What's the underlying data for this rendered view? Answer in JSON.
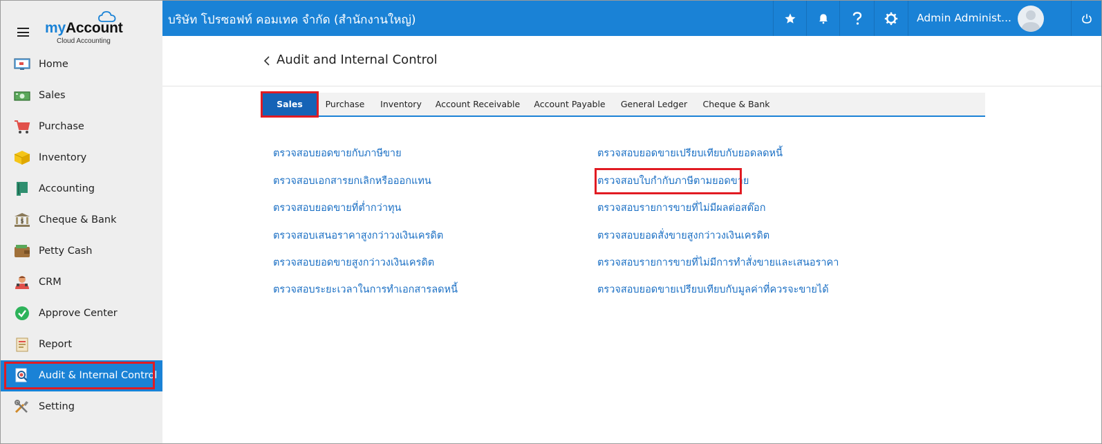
{
  "app": {
    "brand_my": "my",
    "brand_account": "Account",
    "brand_sub": "Cloud Accounting"
  },
  "sidebar": {
    "items": [
      {
        "label": "Home",
        "icon": "monitor-icon"
      },
      {
        "label": "Sales",
        "icon": "money-icon"
      },
      {
        "label": "Purchase",
        "icon": "cart-icon"
      },
      {
        "label": "Inventory",
        "icon": "box-icon"
      },
      {
        "label": "Accounting",
        "icon": "ledger-book-icon"
      },
      {
        "label": "Cheque & Bank",
        "icon": "bank-icon"
      },
      {
        "label": "Petty Cash",
        "icon": "wallet-icon"
      },
      {
        "label": "CRM",
        "icon": "people-icon"
      },
      {
        "label": "Approve Center",
        "icon": "check-circle-icon"
      },
      {
        "label": "Report",
        "icon": "report-icon"
      },
      {
        "label": "Audit & Internal Control",
        "icon": "audit-search-icon",
        "active": true
      },
      {
        "label": "Setting",
        "icon": "tools-icon"
      }
    ]
  },
  "topbar": {
    "company": "บริษัท โปรซอฟท์ คอมเทค จำกัด (สำนักงานใหญ่)",
    "user_name": "Admin Administ..."
  },
  "page": {
    "title": "Audit and Internal Control"
  },
  "tabs": [
    {
      "label": "Sales",
      "active": true
    },
    {
      "label": "Purchase"
    },
    {
      "label": "Inventory"
    },
    {
      "label": "Account Receivable"
    },
    {
      "label": "Account Payable"
    },
    {
      "label": "General Ledger"
    },
    {
      "label": "Cheque & Bank"
    }
  ],
  "links_left": [
    "ตรวจสอบยอดขายกับภาษีขาย",
    "ตรวจสอบเอกสารยกเลิกหรือออกแทน",
    "ตรวจสอบยอดขายที่ต่ำกว่าทุน",
    "ตรวจสอบเสนอราคาสูงกว่าวงเงินเครดิต",
    "ตรวจสอบยอดขายสูงกว่าวงเงินเครดิต",
    "ตรวจสอบระยะเวลาในการทำเอกสารลดหนี้"
  ],
  "links_right": [
    "ตรวจสอบยอดขายเปรียบเทียบกับยอดลดหนี้",
    "ตรวจสอบใบกำกับภาษีตามยอดขาย",
    "ตรวจสอบรายการขายที่ไม่มีผลต่อสต๊อก",
    "ตรวจสอบยอดสั่งขายสูงกว่าวงเงินเครดิต",
    "ตรวจสอบรายการขายที่ไม่มีการทำสั่งขายและเสนอราคา",
    "ตรวจสอบยอดขายเปรียบเทียบกับมูลค่าที่ควรจะขายได้"
  ],
  "colors": {
    "accent": "#1a82d6",
    "active_tab": "#1563b6",
    "link": "#1a6fc4",
    "highlight": "#e11b22"
  }
}
